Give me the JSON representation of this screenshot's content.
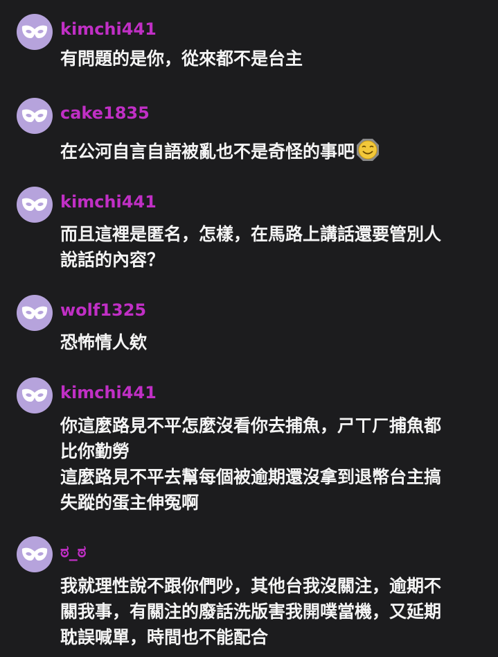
{
  "messages": [
    {
      "username": "kimchi441",
      "lines": [
        "有問題的是你，從來都不是台主"
      ]
    },
    {
      "username": "cake1835",
      "lines": [
        "在公河自言自語被亂也不是奇怪的事吧"
      ],
      "emoji": "grinning-face-emoji"
    },
    {
      "username": "kimchi441",
      "lines": [
        "而且這裡是匿名，怎樣，在馬路上講話還要管別人",
        "說話的內容？"
      ]
    },
    {
      "username": "wolf1325",
      "lines": [
        "恐怖情人欸"
      ]
    },
    {
      "username": "kimchi441",
      "lines": [
        "你這麼路見不平怎麼沒看你去捕魚，ㄕㄒㄏ捕魚都",
        "比你勤勞",
        "這麼路見不平去幫每個被逾期還沒拿到退幣台主搞",
        "失蹤的蛋主伸冤啊"
      ]
    },
    {
      "username": "ಠ_ಠ",
      "lines": [
        "我就理性說不跟你們吵，其他台我沒關注，逾期不",
        "關我事，有關注的廢話洗版害我開噗當機，又延期",
        "耽誤喊單，時間也不能配合"
      ]
    }
  ],
  "colors": {
    "background": "#1c1c1e",
    "username": "#c02fc5",
    "avatar_bg": "#b6a3dc",
    "text": "#f4f4f4"
  },
  "avatar_icon": "mask-icon"
}
